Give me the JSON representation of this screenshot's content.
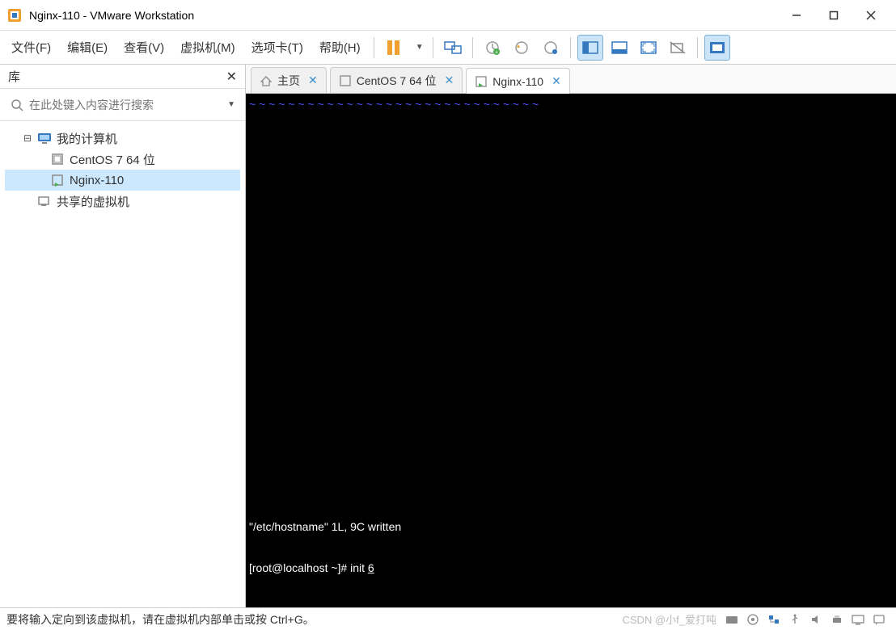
{
  "window": {
    "title": "Nginx-110 - VMware Workstation"
  },
  "menu": {
    "file": "文件(F)",
    "edit": "编辑(E)",
    "view": "查看(V)",
    "vm": "虚拟机(M)",
    "tabs": "选项卡(T)",
    "help": "帮助(H)"
  },
  "sidebar": {
    "title": "库",
    "search_placeholder": "在此处键入内容进行搜索",
    "tree": {
      "root": "我的计算机",
      "items": [
        "CentOS 7 64 位",
        "Nginx-110"
      ],
      "selected": 1,
      "shared": "共享的虚拟机"
    }
  },
  "tabs": [
    {
      "label": "主页",
      "icon": "home",
      "active": false,
      "closable": true
    },
    {
      "label": "CentOS 7 64 位",
      "icon": "vm",
      "active": false,
      "closable": true
    },
    {
      "label": "Nginx-110",
      "icon": "vm-run",
      "active": true,
      "closable": true
    }
  ],
  "terminal": {
    "line1": "\"/etc/hostname\" 1L, 9C written",
    "line2_prefix": "[root@localhost ~]# init ",
    "line2_cmd": "6"
  },
  "status": {
    "text": "要将输入定向到该虚拟机，请在虚拟机内部单击或按 Ctrl+G。",
    "watermark": "CSDN @小f_爱打吨"
  }
}
